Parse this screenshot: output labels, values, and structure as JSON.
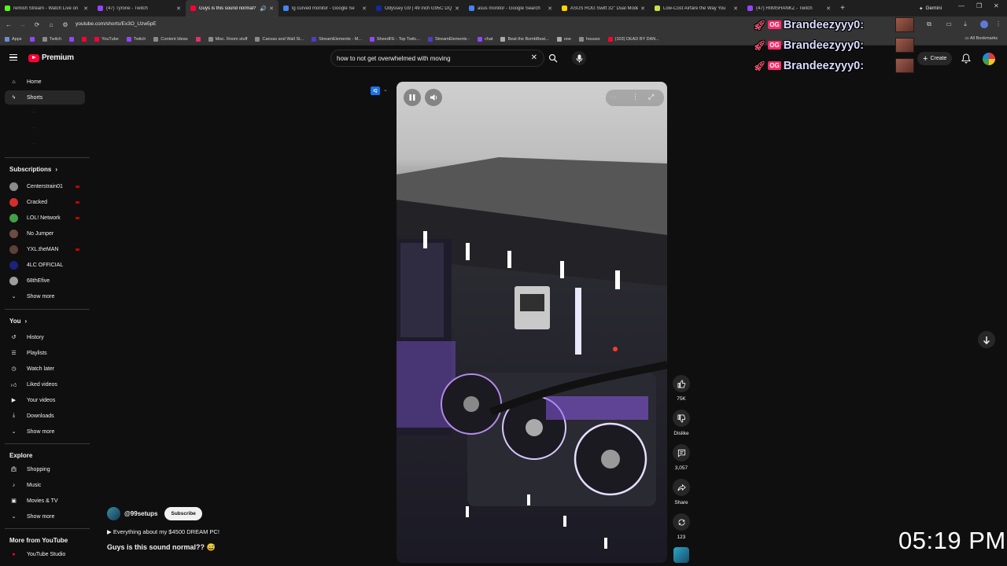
{
  "browser": {
    "tabs": [
      {
        "title": "remish Stream - Watch Live on",
        "color": "#53fc18",
        "active": false
      },
      {
        "title": "(47) Tyrone - Twitch",
        "color": "#9146ff",
        "active": false
      },
      {
        "title": "Guys is this sound normal?",
        "color": "#ff0033",
        "active": true
      },
      {
        "title": "lg curved monitor - Google Se",
        "color": "#4285f4",
        "active": false
      },
      {
        "title": "Odyssey G9 | 49 inch G95C DQ",
        "color": "#1428a0",
        "active": false
      },
      {
        "title": "asus monitor - Google Search",
        "color": "#4285f4",
        "active": false
      },
      {
        "title": "ASUS ROG Swift 32\" Dual Mode",
        "color": "#ffd400",
        "active": false
      },
      {
        "title": "Low-Cost Airfare the Way You",
        "color": "#c6e04c",
        "active": false
      },
      {
        "title": "(47) HIIMSHANKZ - Twitch",
        "color": "#9146ff",
        "active": false
      }
    ],
    "new_tab": "+",
    "gemini_label": "Gemini",
    "url": "youtube.com/shorts/Ex3O_Uzw5pE",
    "bookmarks": [
      {
        "label": "Apps",
        "color": "#6d8bd6"
      },
      {
        "label": "",
        "color": "#9146ff"
      },
      {
        "label": "Twitch",
        "color": "#8a8a8a"
      },
      {
        "label": "",
        "color": "#9146ff"
      },
      {
        "label": "",
        "color": "#ff0033"
      },
      {
        "label": "YouTube",
        "color": "#ff0033"
      },
      {
        "label": "Twitch",
        "color": "#9146ff"
      },
      {
        "label": "Content Ideas",
        "color": "#8a8a8a"
      },
      {
        "label": "",
        "color": "#e1306c"
      },
      {
        "label": "Misc. Room stuff",
        "color": "#8a8a8a"
      },
      {
        "label": "Canvas and Wall St...",
        "color": "#8a8a8a"
      },
      {
        "label": "StreamElements - M...",
        "color": "#4a3fc7"
      },
      {
        "label": "SheedFE - Top Twitc...",
        "color": "#9146ff"
      },
      {
        "label": "StreamElements -",
        "color": "#4a3fc7"
      },
      {
        "label": "chat",
        "color": "#9146ff"
      },
      {
        "label": "Beat the BombBeat...",
        "color": "#aaaaaa"
      },
      {
        "label": "ooe",
        "color": "#aaaaaa"
      },
      {
        "label": "houses",
        "color": "#8a8a8a"
      },
      {
        "label": "(103) DEAD BY DAN...",
        "color": "#ff0033"
      }
    ],
    "all_bookmarks": "All Bookmarks"
  },
  "header": {
    "logo_text": "Premium",
    "search_value": "how to not get overwhelmed with moving",
    "create_label": "Create"
  },
  "sidebar": {
    "main": [
      {
        "label": "Home",
        "icon": "home-icon",
        "active": false
      },
      {
        "label": "Shorts",
        "icon": "shorts-icon",
        "active": true
      }
    ],
    "subscriptions_title": "Subscriptions",
    "subscriptions": [
      {
        "label": "Centerstrain01",
        "color": "#8a8a8a",
        "live": true
      },
      {
        "label": "Cracked",
        "color": "#d32f2f",
        "live": true
      },
      {
        "label": "LOL! Network",
        "color": "#43a047",
        "live": true
      },
      {
        "label": "No Jumper",
        "color": "#6d4c41",
        "live": false
      },
      {
        "label": "YXL.theMAN",
        "color": "#5d4037",
        "live": true
      },
      {
        "label": "4LC OFFICIAL",
        "color": "#1a237e",
        "live": false
      },
      {
        "label": "68thEfive",
        "color": "#9e9e9e",
        "live": false
      }
    ],
    "subs_show_more": "Show more",
    "you_title": "You",
    "you": [
      {
        "label": "History",
        "icon": "history-icon"
      },
      {
        "label": "Playlists",
        "icon": "playlists-icon"
      },
      {
        "label": "Watch later",
        "icon": "watch-later-icon"
      },
      {
        "label": "Liked videos",
        "icon": "liked-videos-icon"
      },
      {
        "label": "Your videos",
        "icon": "your-videos-icon"
      },
      {
        "label": "Downloads",
        "icon": "downloads-icon"
      }
    ],
    "you_show_more": "Show more",
    "explore_title": "Explore",
    "explore": [
      {
        "label": "Shopping",
        "icon": "shopping-icon"
      },
      {
        "label": "Music",
        "icon": "music-icon"
      },
      {
        "label": "Movies & TV",
        "icon": "movies-icon"
      }
    ],
    "explore_show_more": "Show more",
    "more_title": "More from YouTube",
    "more": [
      {
        "label": "YouTube Studio",
        "icon": "youtube-studio-icon"
      }
    ]
  },
  "short": {
    "channel_handle": "@99setups",
    "subscribe_label": "Subscribe",
    "playlist": "Everything about my $4500 DREAM PC!",
    "title": "Guys is this sound normal?? 😅",
    "likes": "75K",
    "dislike_label": "Dislike",
    "comments": "3,057",
    "share_label": "Share",
    "remix_count": "123",
    "badge_text": "iQ"
  },
  "overlay": {
    "chat_lines": [
      {
        "badge": "OG",
        "text": "Brandeezyyy0:"
      },
      {
        "badge": "OG",
        "text": "Brandeezyyy0:"
      },
      {
        "badge": "OG",
        "text": "Brandeezyyy0:"
      }
    ],
    "clock": "05:19 PM"
  },
  "colors": {
    "brand_red": "#ff0033",
    "background": "#0f0f0f",
    "surface": "#272727"
  }
}
